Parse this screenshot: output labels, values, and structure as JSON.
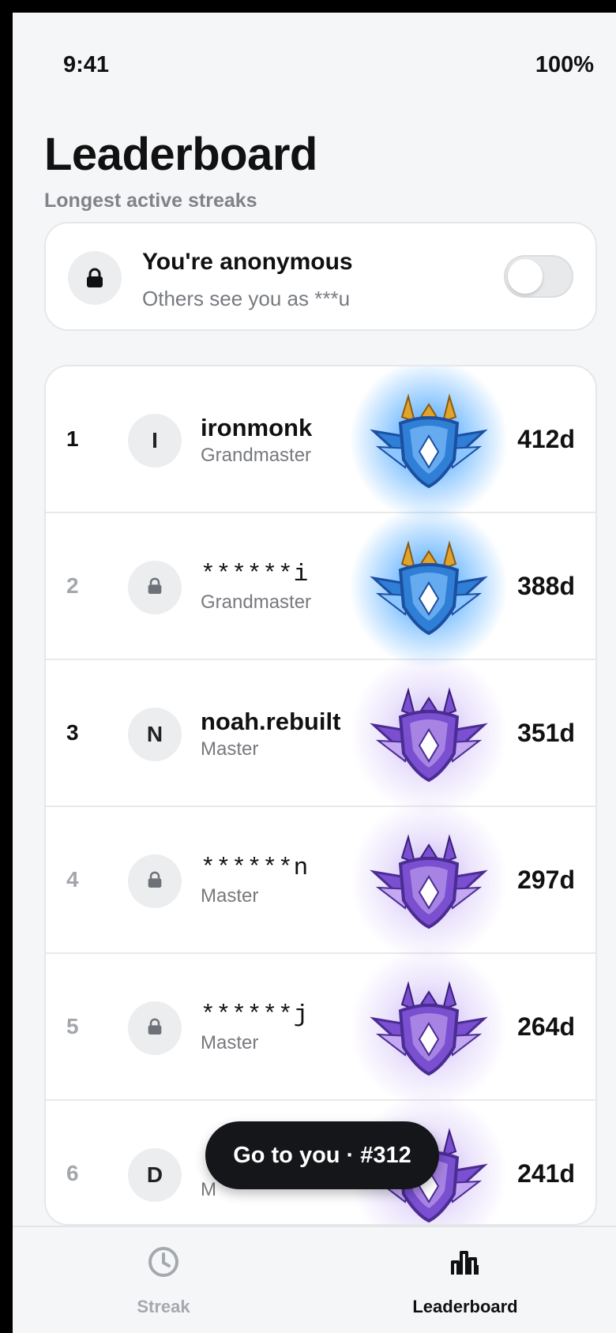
{
  "status_bar": {
    "time": "9:41",
    "battery": "100%"
  },
  "header": {
    "title": "Leaderboard",
    "subtitle": "Longest active streaks"
  },
  "anonymity": {
    "title": "You're anonymous",
    "subtitle": "Others see you as ***u",
    "toggle_on": false,
    "icon": "lock-icon"
  },
  "leaderboard": {
    "rows": [
      {
        "rank": "1",
        "avatar": "I",
        "name": "ironmonk",
        "tier": "Grandmaster",
        "days": "412d",
        "anonymous": false
      },
      {
        "rank": "2",
        "avatar": "",
        "name": "******i",
        "tier": "Grandmaster",
        "days": "388d",
        "anonymous": true
      },
      {
        "rank": "3",
        "avatar": "N",
        "name": "noah.rebuilt",
        "tier": "Master",
        "days": "351d",
        "anonymous": false
      },
      {
        "rank": "4",
        "avatar": "",
        "name": "******n",
        "tier": "Master",
        "days": "297d",
        "anonymous": true
      },
      {
        "rank": "5",
        "avatar": "",
        "name": "******j",
        "tier": "Master",
        "days": "264d",
        "anonymous": true
      },
      {
        "rank": "6",
        "avatar": "D",
        "name": "",
        "tier": "M",
        "days": "241d",
        "anonymous": false
      }
    ],
    "colors": {
      "grandmaster_glow": "#2896ff",
      "master_glow": "#966ee6"
    }
  },
  "floating_button": {
    "label": "Go to you · #312"
  },
  "tab_bar": {
    "tabs": [
      {
        "label": "Streak",
        "icon": "clock-icon",
        "active": false
      },
      {
        "label": "Leaderboard",
        "icon": "bar-chart-icon",
        "active": true
      }
    ]
  }
}
